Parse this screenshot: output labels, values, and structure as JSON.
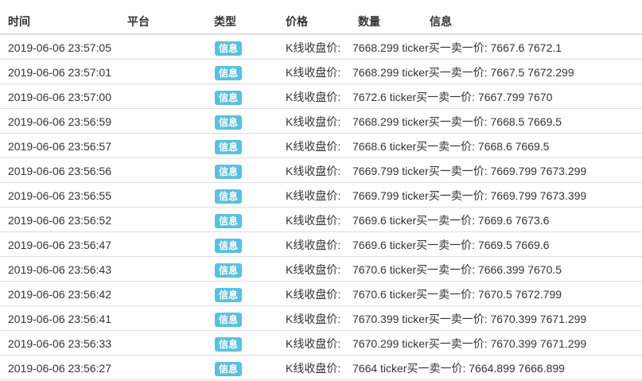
{
  "table": {
    "headers": {
      "time": "时间",
      "platform": "平台",
      "type": "类型",
      "price": "价格",
      "amount": "数量",
      "info": "信息"
    },
    "rows": [
      {
        "time": "2019-06-06 23:57:05",
        "type": "信息",
        "price_label": "K线收盘价:",
        "message": "7668.299 ticker买一卖一价: 7667.6 7672.1"
      },
      {
        "time": "2019-06-06 23:57:01",
        "type": "信息",
        "price_label": "K线收盘价:",
        "message": "7668.299 ticker买一卖一价: 7667.5 7672.299"
      },
      {
        "time": "2019-06-06 23:57:00",
        "type": "信息",
        "price_label": "K线收盘价:",
        "message": "7672.6 ticker买一卖一价: 7667.799 7670"
      },
      {
        "time": "2019-06-06 23:56:59",
        "type": "信息",
        "price_label": "K线收盘价:",
        "message": "7668.299 ticker买一卖一价: 7668.5 7669.5"
      },
      {
        "time": "2019-06-06 23:56:57",
        "type": "信息",
        "price_label": "K线收盘价:",
        "message": "7668.6 ticker买一卖一价: 7668.6 7669.5"
      },
      {
        "time": "2019-06-06 23:56:56",
        "type": "信息",
        "price_label": "K线收盘价:",
        "message": "7669.799 ticker买一卖一价: 7669.799 7673.299"
      },
      {
        "time": "2019-06-06 23:56:55",
        "type": "信息",
        "price_label": "K线收盘价:",
        "message": "7669.799 ticker买一卖一价: 7669.799 7673.399"
      },
      {
        "time": "2019-06-06 23:56:52",
        "type": "信息",
        "price_label": "K线收盘价:",
        "message": "7669.6 ticker买一卖一价: 7669.6 7673.6"
      },
      {
        "time": "2019-06-06 23:56:47",
        "type": "信息",
        "price_label": "K线收盘价:",
        "message": "7669.6 ticker买一卖一价: 7669.5 7669.6"
      },
      {
        "time": "2019-06-06 23:56:43",
        "type": "信息",
        "price_label": "K线收盘价:",
        "message": "7670.6 ticker买一卖一价: 7666.399 7670.5"
      },
      {
        "time": "2019-06-06 23:56:42",
        "type": "信息",
        "price_label": "K线收盘价:",
        "message": "7670.6 ticker买一卖一价: 7670.5 7672.799"
      },
      {
        "time": "2019-06-06 23:56:41",
        "type": "信息",
        "price_label": "K线收盘价:",
        "message": "7670.399 ticker买一卖一价: 7670.399 7671.299"
      },
      {
        "time": "2019-06-06 23:56:33",
        "type": "信息",
        "price_label": "K线收盘价:",
        "message": "7670.299 ticker买一卖一价: 7670.399 7671.299"
      },
      {
        "time": "2019-06-06 23:56:27",
        "type": "信息",
        "price_label": "K线收盘价:",
        "message": "7664 ticker买一卖一价: 7664.899 7666.899"
      }
    ]
  },
  "colors": {
    "badge_background": "#5bc0de",
    "badge_text": "#ffffff",
    "row_border": "#dddddd",
    "text": "#333333"
  }
}
